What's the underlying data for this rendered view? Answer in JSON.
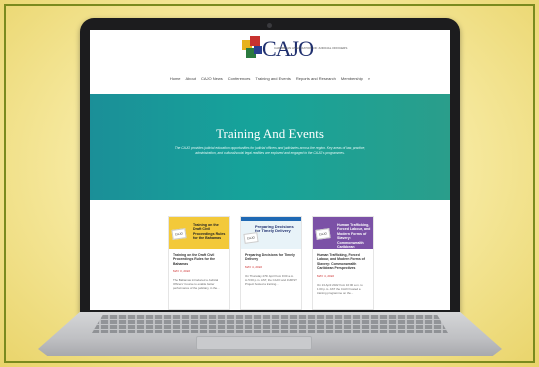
{
  "site": {
    "logo_text": "CAJO",
    "logo_tagline": "CARIBBEAN ASSOCIATION OF JUDICIAL OFFICERS",
    "nav": [
      "Home",
      "About",
      "CAJO News",
      "Conferences",
      "Training and Events",
      "Reports and Research",
      "Membership",
      "⌕"
    ]
  },
  "hero": {
    "title": "Training And Events",
    "description": "The CAJO provides judicial education opportunities for judicial officers and judiciaries across the region. Key areas of law, practice, administration, and cultural/social legal realities are explored and engaged in the CAJO's programmes."
  },
  "cards": [
    {
      "image_text": "Training on the Draft Civil Proceedings Rules for the Bahamas",
      "thumb": "CAJO",
      "title": "Training on the Draft Civil Proceedings Rules for the Bahamas",
      "date": "MAY 3, 2022",
      "excerpt": "The Bahamas introduced a Judicial Officers' Course to enable better performance of the judiciary, in the..."
    },
    {
      "image_text": "Preparing Decisions for Timely Delivery",
      "thumb": "CAJO",
      "title": "Preparing Decisions for Timely Delivery",
      "date": "MAY 4, 2022",
      "excerpt": "On Thursday 27th April from 9:00 a.m. to 5:00 p.m. AST, the CAJO and JURIST Project hosted a training..."
    },
    {
      "image_text": "Human Trafficking, Forced Labour, and Modern Forms of Slavery: Commonwealth Caribbean Perspectives",
      "thumb": "CAJO",
      "title": "Human Trafficking, Forced Labour, and Modern Forms of Slavery: Commonwealth Caribbean Perspectives",
      "date": "MAY 4, 2022",
      "excerpt": "On 13 April 2022 from 10:00 a.m. to 1:00 p.m. AST the CAJO hosted a training programme on the..."
    }
  ],
  "colors": {
    "background": "#f5e79a",
    "hero": "#16a39a",
    "card1": "#f3c93a",
    "card2": "#1f69b4",
    "card3": "#7b51a6",
    "date": "#cc2b2b"
  }
}
